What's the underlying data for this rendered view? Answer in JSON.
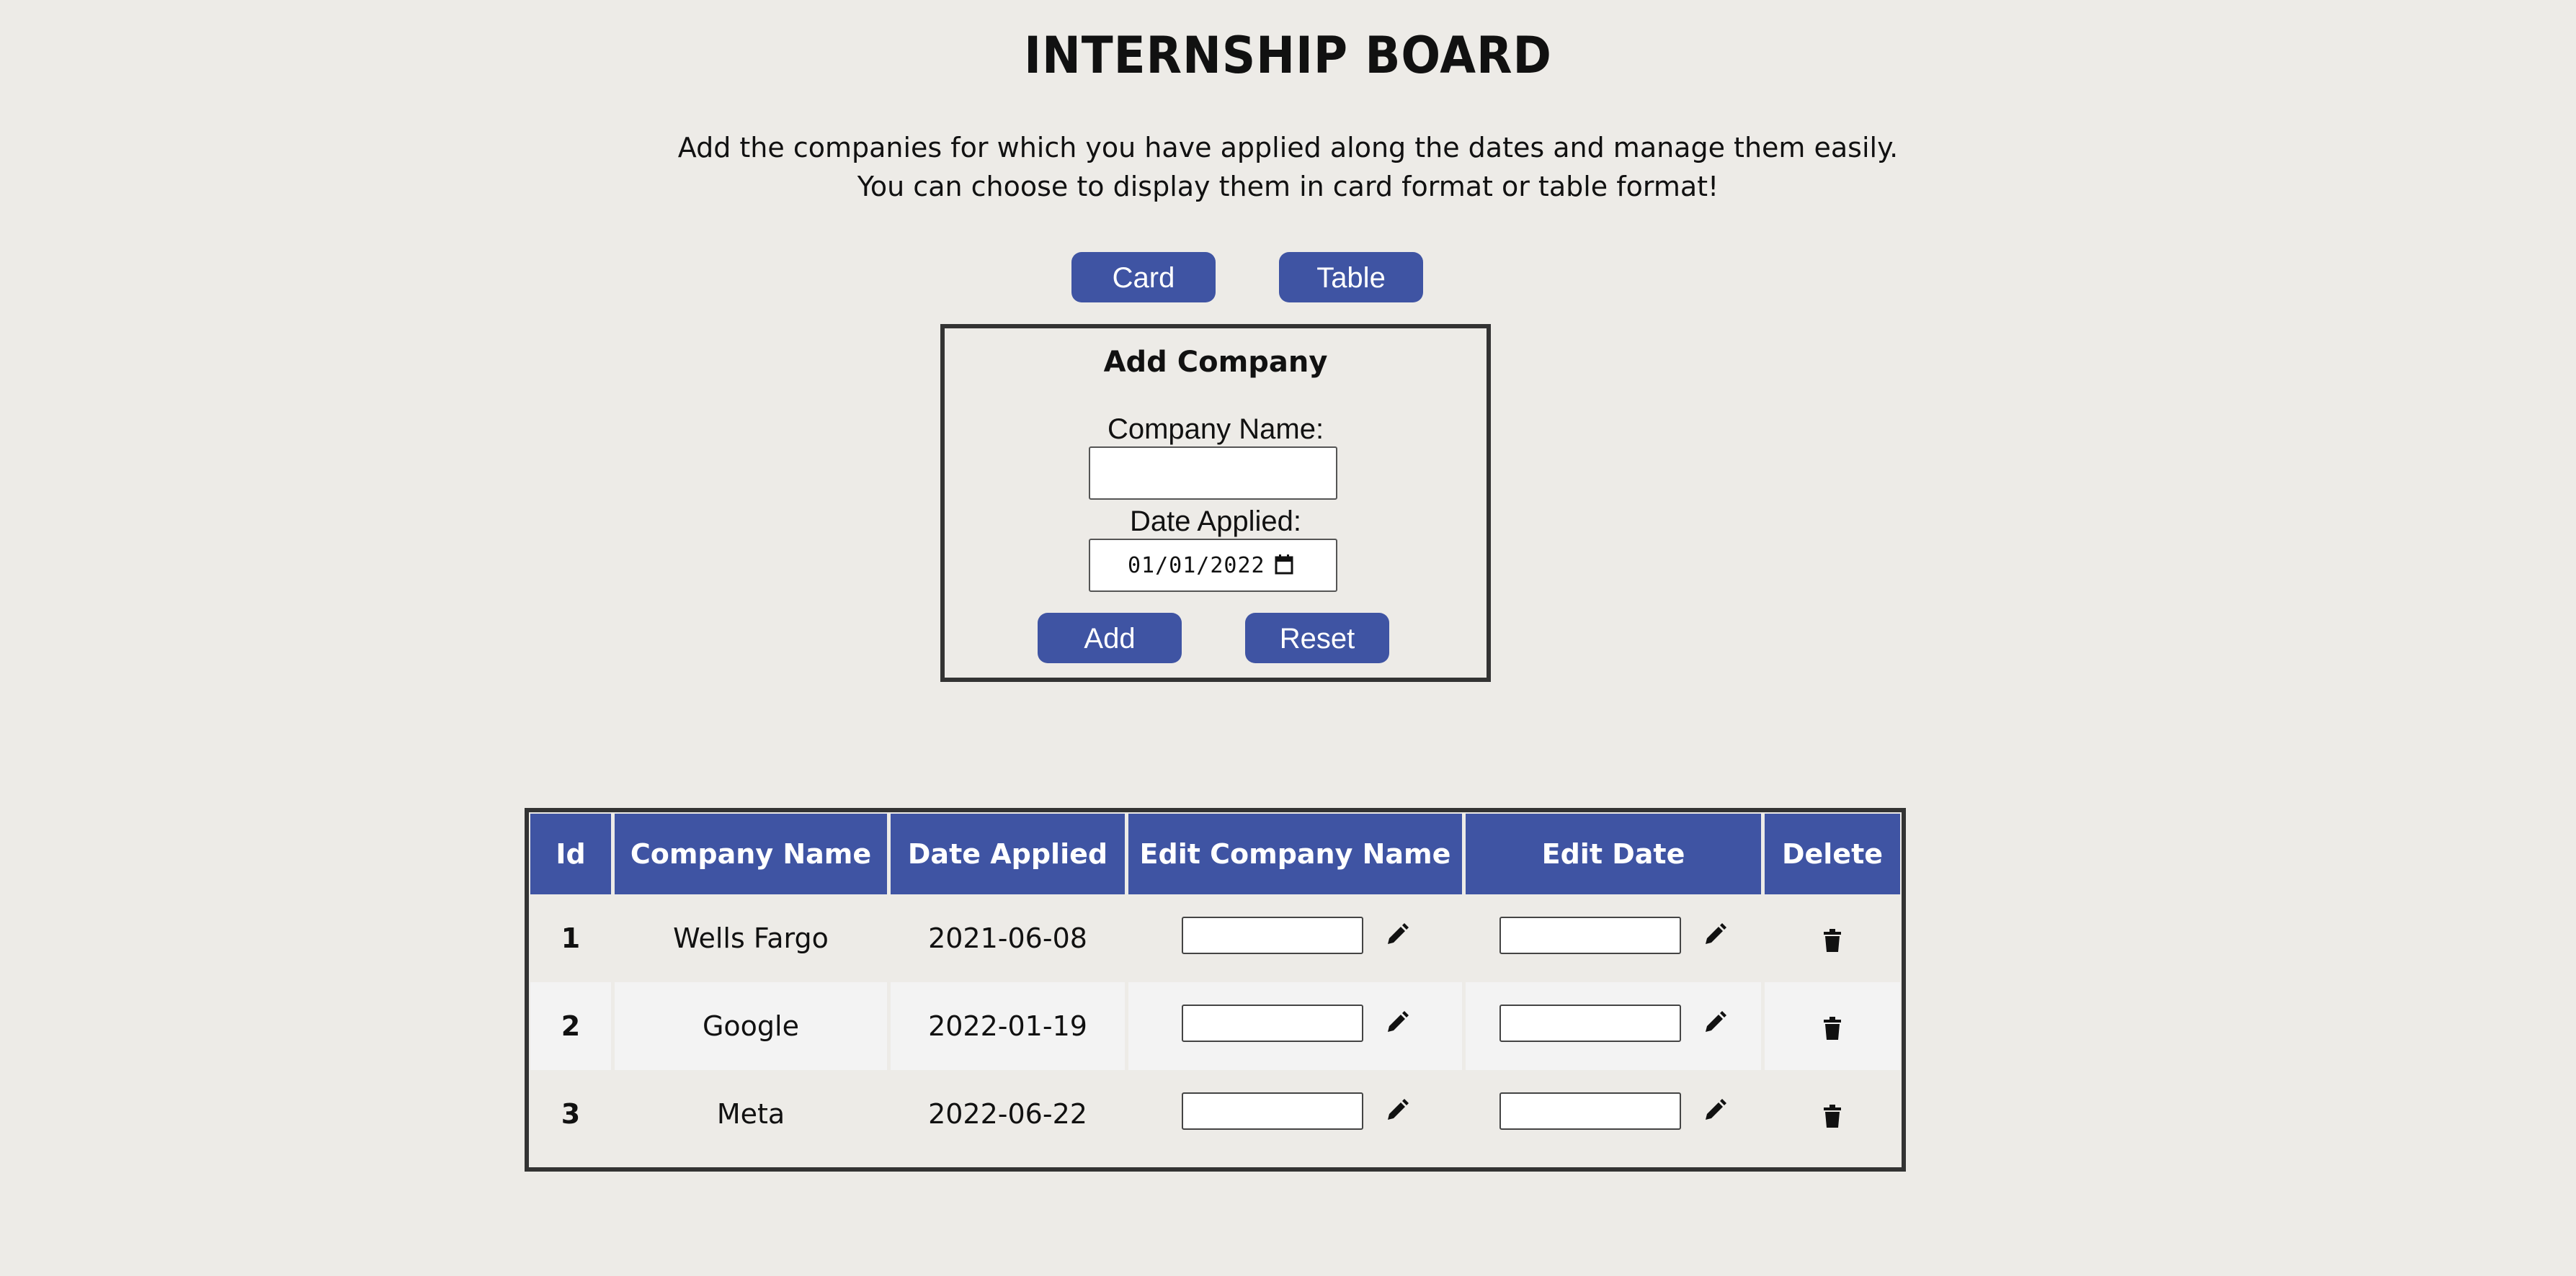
{
  "header": {
    "title": "INTERNSHIP BOARD",
    "subtitle_line1": "Add the companies for which you have applied along the dates and manage them easily.",
    "subtitle_line2": "You can choose to display them in card format or table format!"
  },
  "view_toggle": {
    "card_label": "Card",
    "table_label": "Table"
  },
  "add_form": {
    "title": "Add Company",
    "company_name_label": "Company Name:",
    "company_name_value": "",
    "date_label": "Date Applied:",
    "date_value": "01/01/2022",
    "add_label": "Add",
    "reset_label": "Reset"
  },
  "table": {
    "headers": [
      "Id",
      "Company Name",
      "Date Applied",
      "Edit Company Name",
      "Edit Date",
      "Delete"
    ],
    "rows": [
      {
        "id": "1",
        "company": "Wells Fargo",
        "date": "2021-06-08"
      },
      {
        "id": "2",
        "company": "Google",
        "date": "2022-01-19"
      },
      {
        "id": "3",
        "company": "Meta",
        "date": "2022-06-22"
      }
    ]
  },
  "colors": {
    "accent": "#3f54a3",
    "background": "#edebe7",
    "border": "#333333"
  },
  "icons": {
    "edit": "pencil-icon",
    "delete": "trash-icon",
    "calendar": "calendar-icon"
  }
}
